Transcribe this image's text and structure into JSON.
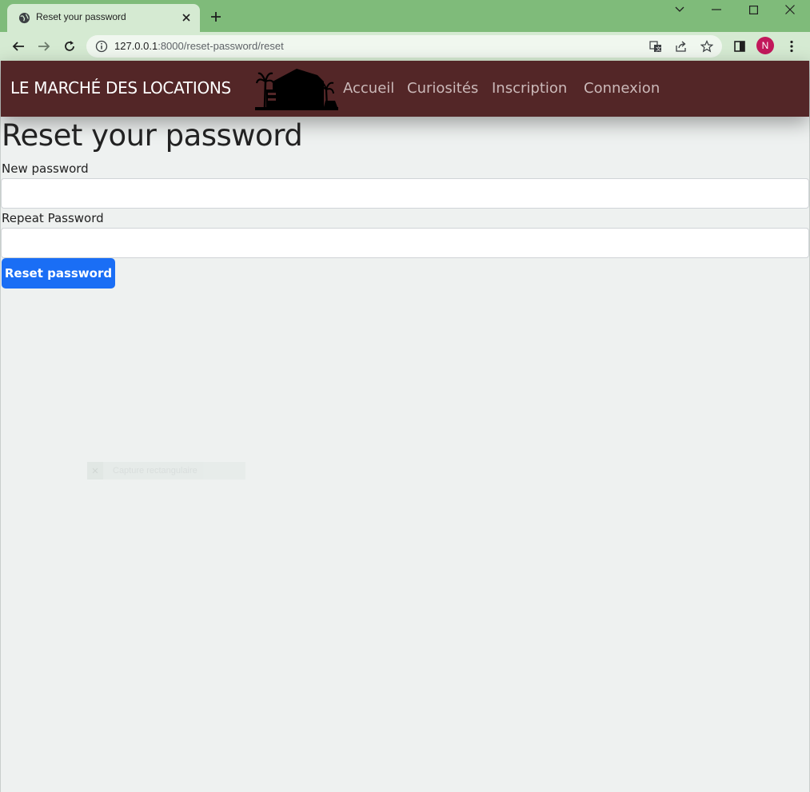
{
  "browser": {
    "tab_title": "Reset your password",
    "url_host": "127.0.0.1",
    "url_rest": ":8000/reset-password/reset",
    "profile_initial": "N"
  },
  "navbar": {
    "brand": "LE MARCHÉ DES LOCATIONS",
    "links": [
      "Accueil",
      "Curiosités",
      "Inscription",
      "Connexion"
    ]
  },
  "form": {
    "title": "Reset your password",
    "new_password_label": "New password",
    "repeat_password_label": "Repeat Password",
    "submit_label": "Reset password"
  },
  "overlay": {
    "ghost_text": "Capture rectangulaire"
  },
  "colors": {
    "titlebar": "#7fbb7a",
    "toolbar": "#d5ead2",
    "navbar": "#532627",
    "button": "#1a6ef5",
    "page_bg": "#eef1f0"
  }
}
